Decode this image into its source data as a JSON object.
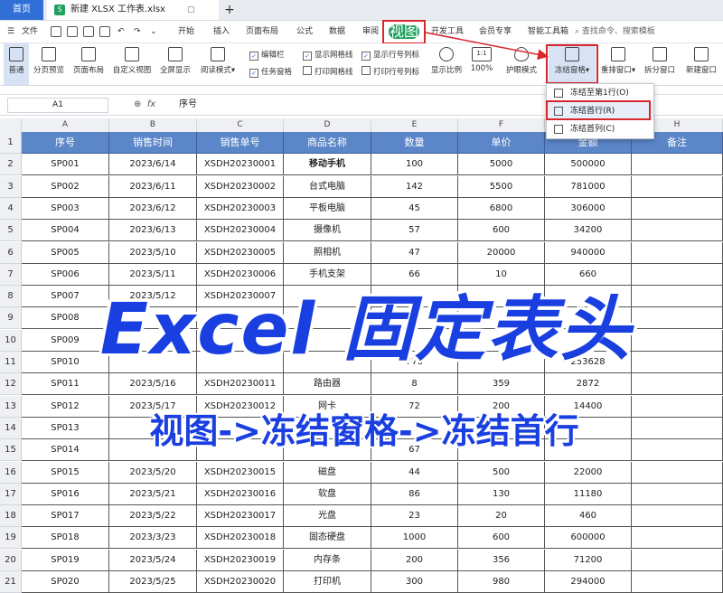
{
  "titlebar": {
    "home_tab": "首页",
    "file_tab": "新建 XLSX 工作表.xlsx",
    "file_icon_letter": "S",
    "add_tab": "+"
  },
  "menu": {
    "file": "文件",
    "items": [
      "开始",
      "插入",
      "页面布局",
      "公式",
      "数据",
      "审阅",
      "视图",
      "开发工具",
      "会员专享",
      "智能工具箱"
    ],
    "search_placeholder": "查找命令、搜索模板"
  },
  "ribbon": {
    "buttons": [
      "普通",
      "分页预览",
      "页面布局",
      "自定义视图",
      "全屏显示",
      "阅读模式"
    ],
    "checks_col1": [
      "编辑栏",
      "任务窗格"
    ],
    "checks_col2": [
      "显示网格线",
      "打印网格线"
    ],
    "checks_col3": [
      "显示行号列标",
      "打印行号列标"
    ],
    "zoom_label": "显示比例",
    "zoom_value": "100%",
    "zoom_icon_text": "1:1",
    "right_buttons": [
      "护眼模式",
      "冻结窗格",
      "重排窗口",
      "拆分窗口",
      "新建窗口"
    ]
  },
  "formula_bar": {
    "name_box": "A1",
    "fx": "fx",
    "value": "序号"
  },
  "dropdown": {
    "items": [
      "冻结至第1行(O)",
      "冻结首行(R)",
      "冻结首列(C)"
    ]
  },
  "columns": [
    "A",
    "B",
    "C",
    "D",
    "E",
    "F",
    "G",
    "H"
  ],
  "header_row": [
    "序号",
    "销售时间",
    "销售单号",
    "商品名称",
    "数量",
    "单价",
    "金额",
    "备注"
  ],
  "rows": [
    [
      "SP001",
      "2023/6/14",
      "XSDH20230001",
      "移动手机",
      "100",
      "5000",
      "500000",
      ""
    ],
    [
      "SP002",
      "2023/6/11",
      "XSDH20230002",
      "台式电脑",
      "142",
      "5500",
      "781000",
      ""
    ],
    [
      "SP003",
      "2023/6/12",
      "XSDH20230003",
      "平板电脑",
      "45",
      "6800",
      "306000",
      ""
    ],
    [
      "SP004",
      "2023/6/13",
      "XSDH20230004",
      "摄像机",
      "57",
      "600",
      "34200",
      ""
    ],
    [
      "SP005",
      "2023/5/10",
      "XSDH20230005",
      "照相机",
      "47",
      "20000",
      "940000",
      ""
    ],
    [
      "SP006",
      "2023/5/11",
      "XSDH20230006",
      "手机支架",
      "66",
      "10",
      "660",
      ""
    ],
    [
      "SP007",
      "2023/5/12",
      "XSDH20230007",
      "",
      "",
      "",
      "",
      ""
    ],
    [
      "SP008",
      "",
      "",
      "",
      "",
      "",
      "",
      ""
    ],
    [
      "SP009",
      "",
      "",
      "",
      "",
      "",
      "",
      ""
    ],
    [
      "SP010",
      "",
      "",
      "",
      "778",
      "",
      "253628",
      ""
    ],
    [
      "SP011",
      "2023/5/16",
      "XSDH20230011",
      "路由器",
      "8",
      "359",
      "2872",
      ""
    ],
    [
      "SP012",
      "2023/5/17",
      "XSDH20230012",
      "网卡",
      "72",
      "200",
      "14400",
      ""
    ],
    [
      "SP013",
      "",
      "",
      "",
      "",
      "",
      "",
      ""
    ],
    [
      "SP014",
      "",
      "",
      "",
      "67",
      "",
      "",
      ""
    ],
    [
      "SP015",
      "2023/5/20",
      "XSDH20230015",
      "磁盘",
      "44",
      "500",
      "22000",
      ""
    ],
    [
      "SP016",
      "2023/5/21",
      "XSDH20230016",
      "软盘",
      "86",
      "130",
      "11180",
      ""
    ],
    [
      "SP017",
      "2023/5/22",
      "XSDH20230017",
      "光盘",
      "23",
      "20",
      "460",
      ""
    ],
    [
      "SP018",
      "2023/3/23",
      "XSDH20230018",
      "固态硬盘",
      "1000",
      "600",
      "600000",
      ""
    ],
    [
      "SP019",
      "2023/5/24",
      "XSDH20230019",
      "内存条",
      "200",
      "356",
      "71200",
      ""
    ],
    [
      "SP020",
      "2023/5/25",
      "XSDH20230020",
      "打印机",
      "300",
      "980",
      "294000",
      ""
    ]
  ],
  "overlay": {
    "title": "Excel 固定表头",
    "subtitle": "视图->冻结窗格->冻结首行"
  },
  "colors": {
    "header_fill": "#5b86c8",
    "highlight_red": "#d8262b",
    "overlay_blue": "#1a3fe0",
    "view_tab_green": "#1fa15d"
  }
}
